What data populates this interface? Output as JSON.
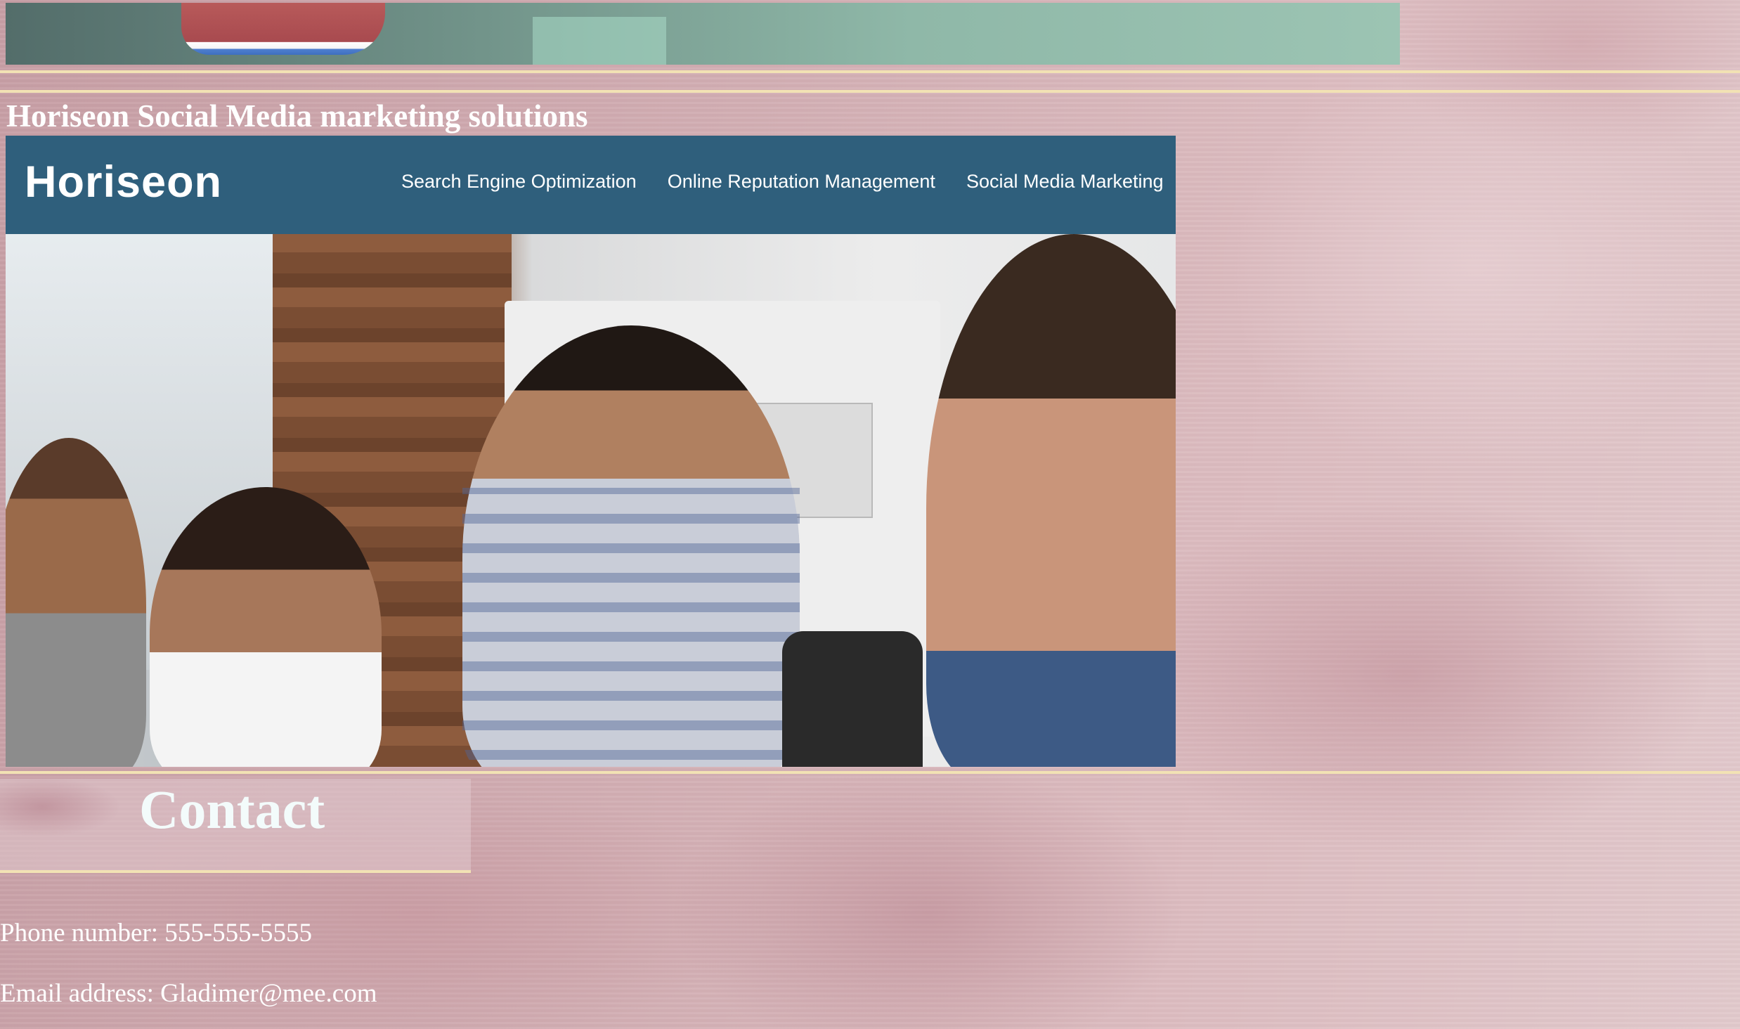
{
  "section": {
    "title": "Horiseon Social Media marketing solutions"
  },
  "screenshot": {
    "logo": "Horiseon",
    "nav": [
      "Search Engine Optimization",
      "Online Reputation Management",
      "Social Media Marketing"
    ]
  },
  "contact": {
    "heading": "Contact",
    "phone": "Phone number: 555-555-5555",
    "email": "Email address: Gladimer@mee.com"
  },
  "colors": {
    "accent_line": "#f2e2b4",
    "nav_blue": "#2f5f7c",
    "text": "#ffffff"
  }
}
